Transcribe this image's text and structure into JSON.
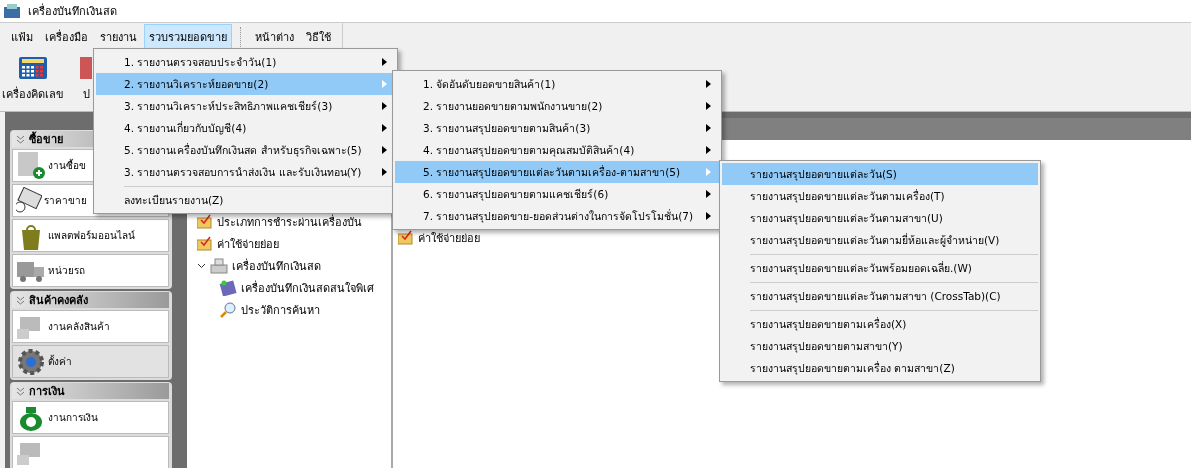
{
  "window": {
    "title": "เครื่องบันทึกเงินสด"
  },
  "menubar": [
    {
      "label": "แฟ้ม",
      "selected": false
    },
    {
      "label": "เครื่องมือ",
      "selected": false
    },
    {
      "label": "รายงาน",
      "selected": false
    },
    {
      "label": "รวบรวมยอดขาย",
      "selected": true
    },
    {
      "label": "หน้าต่าง",
      "selected": false
    },
    {
      "label": "วิธีใช้",
      "selected": false
    }
  ],
  "toolbar": [
    {
      "label": "เครื่องคิดเลข",
      "kind": "calculator"
    },
    {
      "label": "ป",
      "kind": "other"
    }
  ],
  "sidebar": [
    {
      "title": "ซื้อขาย",
      "items": [
        {
          "label": "งานซื้อข",
          "kind": "add",
          "selected": false
        },
        {
          "label": "ราคาขาย",
          "kind": "tag",
          "selected": false
        },
        {
          "label": "แพลตฟอร์มออนไลน์",
          "kind": "shop",
          "selected": false
        },
        {
          "label": "หน่วยรถ",
          "kind": "truck",
          "selected": false
        }
      ]
    },
    {
      "title": "สินค้าคงคลัง",
      "items": [
        {
          "label": "งานคลังสินค้า",
          "kind": "stock",
          "selected": false
        },
        {
          "label": "ตั้งค่า",
          "kind": "gear",
          "selected": true
        }
      ]
    },
    {
      "title": "การเงิน",
      "items": [
        {
          "label": "งานการเงิน",
          "kind": "money",
          "selected": false
        },
        {
          "kind": "stock",
          "selected": false
        }
      ]
    }
  ],
  "tree": [
    {
      "label": "ประเภทการชำระผ่านเครื่องบัน",
      "kind": "folder"
    },
    {
      "label": "ค่าใช้จ่ายย่อย",
      "kind": "folder"
    },
    {
      "label": "เครื่องบันทึกเงินสด",
      "kind": "register",
      "expanded": true,
      "children": [
        {
          "label": "เครื่องบันทึกเงินสดสนใจพิเศ",
          "kind": "book"
        },
        {
          "label": "ประวัติการค้นหา",
          "kind": "search"
        }
      ]
    }
  ],
  "list": [
    {
      "label": "ค่าใช้จ่ายย่อย"
    }
  ],
  "menus": [
    {
      "items": [
        {
          "label": "1. รายงานตรวจสอบประจำวัน(1)",
          "submenu": true,
          "selected": false
        },
        {
          "label": "2. รายงานวิเคราะห์ยอดขาย(2)",
          "submenu": true,
          "selected": true
        },
        {
          "label": "3. รายงานวิเคราะห์ประสิทธิภาพแคชเชียร์(3)",
          "submenu": true,
          "selected": false
        },
        {
          "label": "4. รายงานเกี่ยวกับบัญชี(4)",
          "submenu": true,
          "selected": false
        },
        {
          "label": "5. รายงานเครื่องบันทึกเงินสด สำหรับธุรกิจเฉพาะ(5)",
          "submenu": true,
          "selected": false
        },
        {
          "label": "3. รายงานตรวจสอบการนำส่งเงิน และรับเงินทอน(Y)",
          "submenu": true,
          "selected": false
        },
        {
          "label": "ลงทะเบียนรายงาน(Z)",
          "submenu": false,
          "selected": false,
          "divider_before": true
        }
      ]
    },
    {
      "items": [
        {
          "label": "1. จัดอันดับยอดขายสินค้า(1)",
          "submenu": true,
          "selected": false
        },
        {
          "label": "2. รายงานยอดขายตามพนักงานขาย(2)",
          "submenu": true,
          "selected": false
        },
        {
          "label": "3. รายงานสรุปยอดขายตามสินค้า(3)",
          "submenu": true,
          "selected": false
        },
        {
          "label": "4. รายงานสรุปยอดขายตามคุณสมบัติสินค้า(4)",
          "submenu": true,
          "selected": false
        },
        {
          "label": "5. รายงานสรุปยอดขายแต่ละวันตามเครื่อง-ตามสาขา(5)",
          "submenu": true,
          "selected": true
        },
        {
          "label": "6. รายงานสรุปยอดขายตามแคชเชียร์(6)",
          "submenu": true,
          "selected": false
        },
        {
          "label": "7. รายงานสรุปยอดขาย-ยอดส่วนต่างในการจัดโปรโมชั่น(7)",
          "submenu": true,
          "selected": false
        }
      ]
    },
    {
      "items": [
        {
          "label": "รายงานสรุปยอดขายแต่ละวัน(S)",
          "submenu": false,
          "selected": true
        },
        {
          "label": "รายงานสรุปยอดขายแต่ละวันตามเครื่อง(T)",
          "submenu": false,
          "selected": false
        },
        {
          "label": "รายงานสรุปยอดขายแต่ละวันตามสาขา(U)",
          "submenu": false,
          "selected": false
        },
        {
          "label": "รายงานสรุปยอดขายแต่ละวันตามยี่ห้อและผู้จำหน่าย(V)",
          "submenu": false,
          "selected": false
        },
        {
          "label": "รายงานสรุปยอดขายแต่ละวันพร้อมยอดเฉลี่ย.(W)",
          "submenu": false,
          "selected": false,
          "divider_before": true
        },
        {
          "label": "รายงานสรุปยอดขายแต่ละวันตามสาขา (CrossTab)(C)",
          "submenu": false,
          "selected": false,
          "divider_before": true
        },
        {
          "label": "รายงานสรุปยอดขายตามเครื่อง(X)",
          "submenu": false,
          "selected": false,
          "divider_before": true
        },
        {
          "label": "รายงานสรุปยอดขายตามสาขา(Y)",
          "submenu": false,
          "selected": false
        },
        {
          "label": "รายงานสรุปยอดขายตามเครื่อง ตามสาขา(Z)",
          "submenu": false,
          "selected": false
        }
      ]
    }
  ]
}
